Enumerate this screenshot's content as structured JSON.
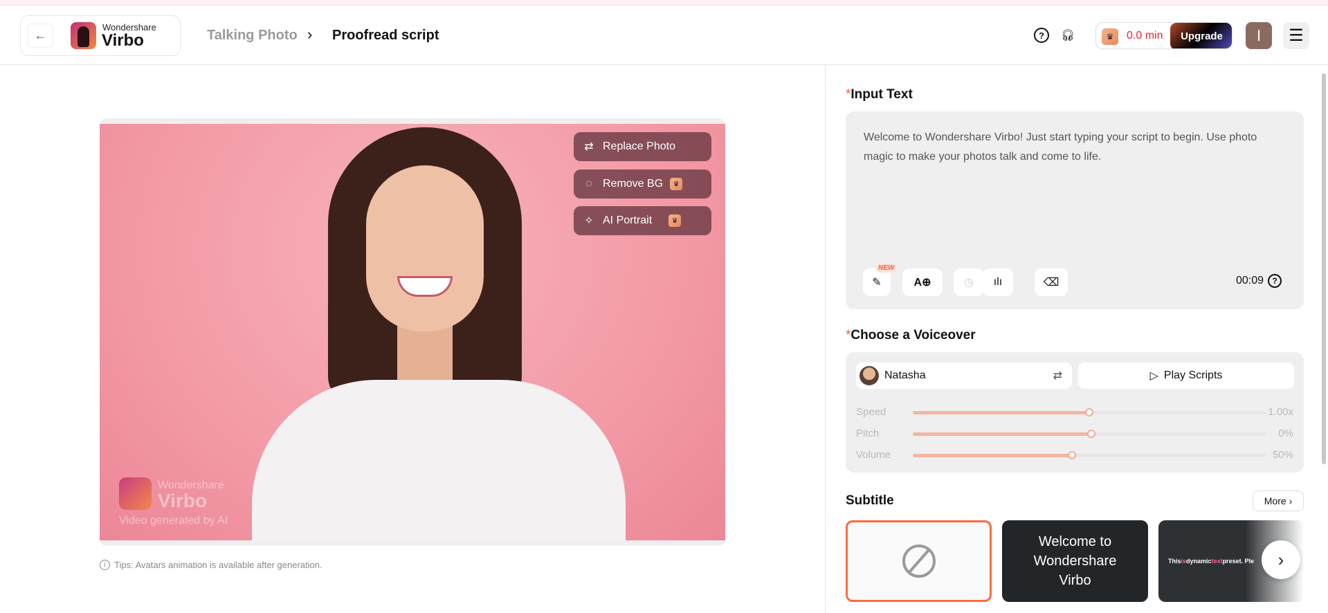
{
  "header": {
    "logo_top": "Wondershare",
    "logo_bottom": "Virbo",
    "breadcrumb": [
      "Talking Photo",
      "Proofread script"
    ],
    "credits": "0.0 min",
    "upgrade": "Upgrade",
    "avatar_initial": "I"
  },
  "photo": {
    "buttons": [
      "Replace Photo",
      "Remove BG",
      "AI Portrait"
    ],
    "watermark": {
      "top": "Wondershare",
      "bottom": "Virbo",
      "caption": "Video generated by AI"
    },
    "tips": "Tips: Avatars animation is available after generation."
  },
  "input_text": {
    "required": "*",
    "label": "Input Text",
    "value": "Welcome to Wondershare Virbo! Just start typing your script to begin. Use photo magic to make your photos talk and come to life.",
    "new_badge": "NEW",
    "duration": "00:09"
  },
  "voiceover": {
    "required": "*",
    "label": "Choose a Voiceover",
    "voice": "Natasha",
    "play": "Play Scripts",
    "sliders": [
      {
        "label": "Speed",
        "value": "1.00x",
        "fraction": 0.5
      },
      {
        "label": "Pitch",
        "value": "0%",
        "fraction": 0.505
      },
      {
        "label": "Volume",
        "value": "50%",
        "fraction": 0.45
      }
    ]
  },
  "subtitle": {
    "label": "Subtitle",
    "more": "More",
    "preset1": "Welcome to Wondershare Virbo",
    "preset2": [
      "This ",
      "is",
      " dynamic ",
      "text",
      " preset. Ple"
    ],
    "accent": "#ff5aa0"
  },
  "colors": {
    "accent": "#ff6a3d",
    "credits": "#ff1a2a"
  }
}
